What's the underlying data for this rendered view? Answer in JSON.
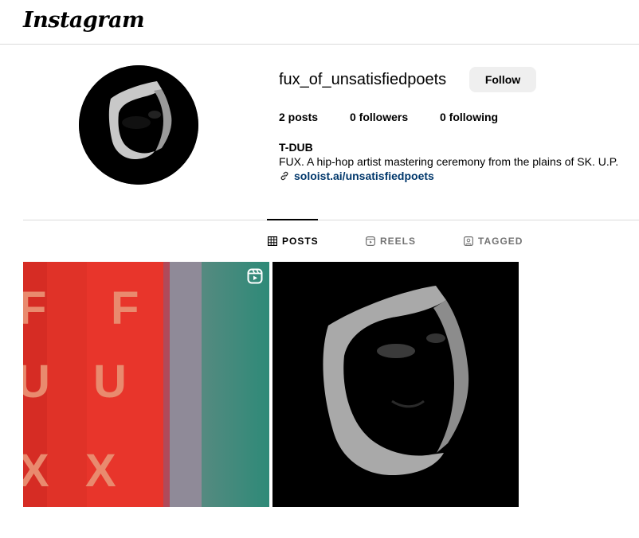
{
  "header": {
    "logo_text": "Instagram"
  },
  "profile": {
    "username": "fux_of_unsatisfiedpoets",
    "follow_label": "Follow",
    "stats": {
      "posts": "2 posts",
      "followers": "0 followers",
      "following": "0 following"
    },
    "full_name": "T-DUB",
    "bio": "FUX. A hip-hop artist mastering ceremony from the plains of SK. U.P.",
    "link": "soloist.ai/unsatisfiedpoets"
  },
  "tabs": [
    {
      "label": "POSTS",
      "icon": "grid-icon",
      "active": true
    },
    {
      "label": "REELS",
      "icon": "reels-icon",
      "active": false
    },
    {
      "label": "TAGGED",
      "icon": "tagged-icon",
      "active": false
    }
  ],
  "posts": [
    {
      "type": "reel",
      "letters": [
        "F",
        "U",
        "X"
      ],
      "icon": "reel-badge-icon"
    },
    {
      "type": "image"
    }
  ],
  "colors": {
    "link": "#00376b",
    "border": "#dbdbdb",
    "button_bg": "#efefef",
    "muted": "#737373"
  }
}
